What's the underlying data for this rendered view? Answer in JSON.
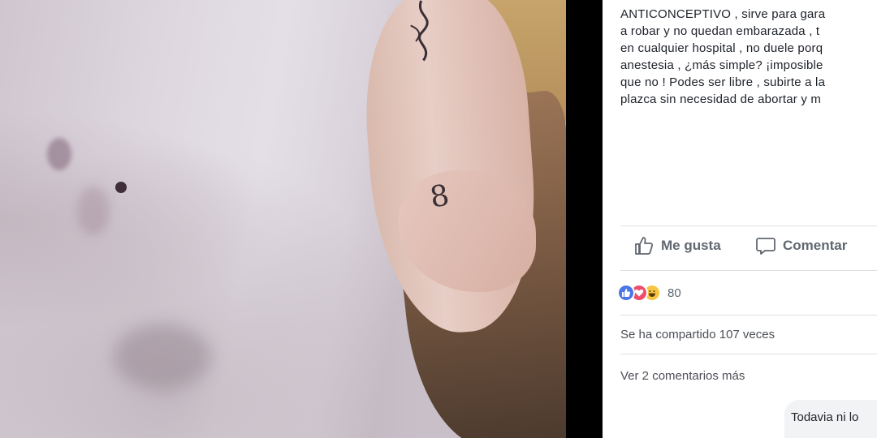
{
  "post": {
    "text_lines": [
      "ANTICONCEPTIVO , sirve para gara",
      "a robar y no quedan embarazada , t",
      "en cualquier hospital , no duele porq",
      "anestesia , ¿más simple? ¡imposible",
      "que no ! Podes ser libre , subirte a la",
      "plazca sin necesidad de abortar y m"
    ]
  },
  "actions": {
    "like_label": "Me gusta",
    "comment_label": "Comentar"
  },
  "reactions": {
    "icons": [
      "like",
      "love",
      "haha"
    ],
    "count": "80",
    "colors": {
      "like": "#4a76e8",
      "love": "#ef4d6c",
      "haha": "#f7c640"
    }
  },
  "shares_text": "Se ha compartido 107 veces",
  "more_comments_text": "Ver 2 comentarios más",
  "comment_preview": "Todavia ni lo",
  "photo": {
    "tattoo_glyph": "8"
  }
}
